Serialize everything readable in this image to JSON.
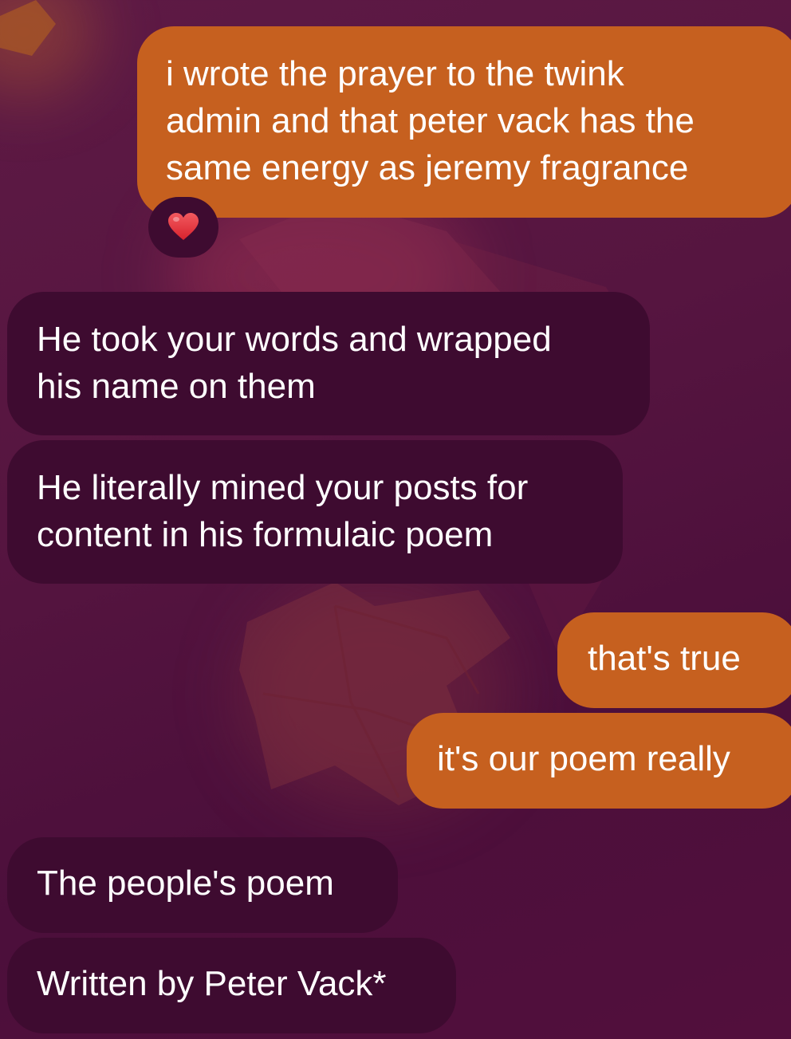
{
  "messages": [
    {
      "direction": "outgoing",
      "lines": [
        "i wrote the prayer to the twink",
        "admin and that peter vack has the",
        "same energy as jeremy fragrance"
      ],
      "reaction": "red-heart"
    },
    {
      "direction": "incoming",
      "lines": [
        "He took your words and wrapped",
        "his name on them"
      ]
    },
    {
      "direction": "incoming",
      "lines": [
        "He literally mined your posts for",
        "content in his formulaic poem"
      ]
    },
    {
      "direction": "outgoing",
      "lines": [
        "that's true"
      ]
    },
    {
      "direction": "outgoing",
      "lines": [
        "it's our poem really"
      ]
    },
    {
      "direction": "incoming",
      "lines": [
        "The people's poem"
      ]
    },
    {
      "direction": "incoming",
      "lines": [
        "Written by Peter Vack*"
      ]
    }
  ],
  "colors": {
    "outgoing_bubble": "#c6601f",
    "incoming_bubble": "#3e0b30",
    "background": "#561540",
    "reaction_heart": "#e8323b",
    "text": "#ffffff"
  }
}
